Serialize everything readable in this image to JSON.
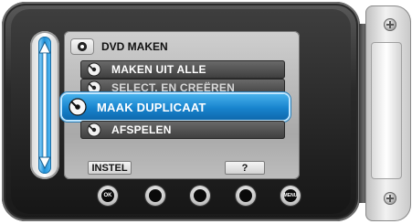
{
  "screen": {
    "title": "DVD MAKEN",
    "items": [
      {
        "label": "MAKEN UIT ALLE",
        "state": "normal"
      },
      {
        "label": "SELECT. EN CREËREN",
        "state": "dim"
      },
      {
        "label": "MAAK DUPLICAAT",
        "state": "selected"
      },
      {
        "label": "AFSPELEN",
        "state": "normal"
      }
    ]
  },
  "soft_buttons": {
    "set_label": "INSTEL",
    "help_label": "?"
  },
  "hardware_buttons": {
    "ok_label": "OK",
    "menu_label": "MENU"
  },
  "colors": {
    "selection": "#1783cd",
    "slider": "#1e8fd6",
    "item_bg": "#4a4a4a"
  }
}
